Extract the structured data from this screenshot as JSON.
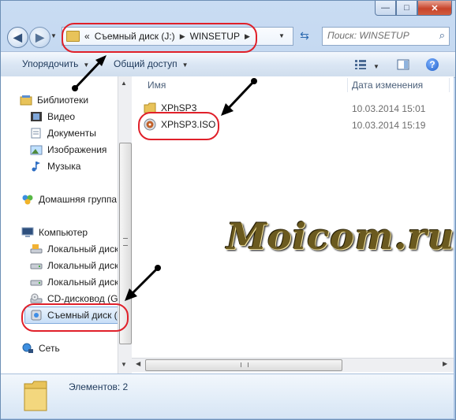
{
  "titlebar": {
    "minimize_glyph": "—",
    "maximize_glyph": "□",
    "close_glyph": "✕"
  },
  "address": {
    "chevron": "«",
    "segments": [
      "Съемный диск (J:)",
      "WINSETUP"
    ],
    "search_placeholder": "Поиск: WINSETUP"
  },
  "toolbar": {
    "organize_label": "Упорядочить",
    "share_label": "Общий доступ"
  },
  "nav": {
    "libraries": "Библиотеки",
    "video": "Видео",
    "documents": "Документы",
    "images": "Изображения",
    "music": "Музыка",
    "homegroup": "Домашняя группа",
    "computer": "Компьютер",
    "local_disk_1": "Локальный диск",
    "local_disk_2": "Локальный диск",
    "local_disk_3": "Локальный диск",
    "cd_drive": "CD-дисковод (G:",
    "removable": "Съемный диск (.",
    "network": "Сеть"
  },
  "columns": {
    "name": "Имя",
    "date": "Дата изменения"
  },
  "files": [
    {
      "name": "XPhSP3",
      "date": "10.03.2014 15:01"
    },
    {
      "name": "XPhSP3.ISO",
      "date": "10.03.2014 15:19"
    }
  ],
  "watermark": "Moicom.ru",
  "status": {
    "count": "Элементов: 2"
  },
  "colors": {
    "annotation_red": "#e0202a",
    "folder_yellow": "#e8c35a"
  }
}
